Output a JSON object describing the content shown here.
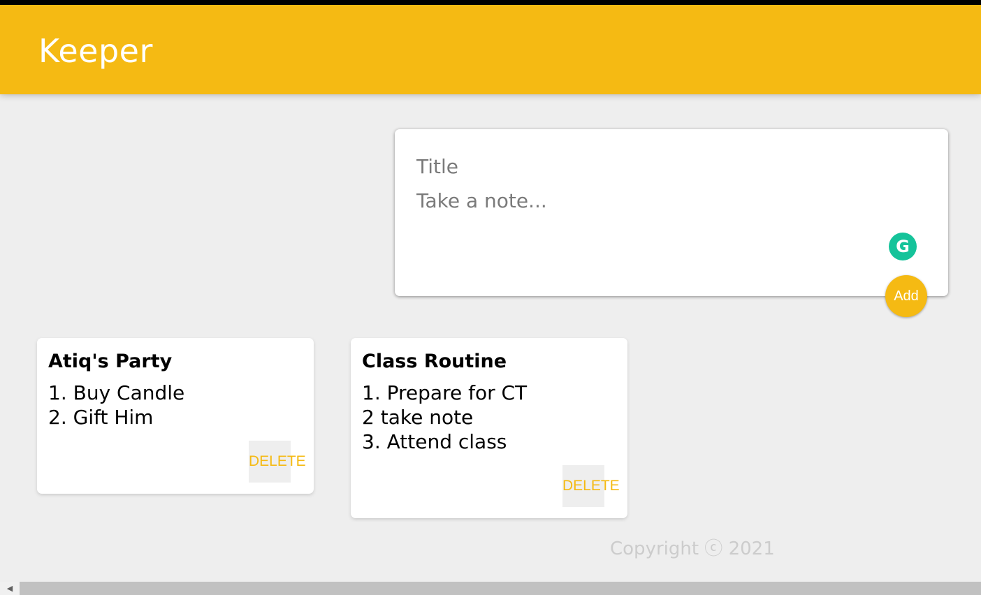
{
  "header": {
    "title": "Keeper"
  },
  "create_note": {
    "title_placeholder": "Title",
    "content_placeholder": "Take a note...",
    "add_label": "Add"
  },
  "notes": [
    {
      "title": "Atiq's Party",
      "lines": [
        "1. Buy Candle",
        "2. Gift Him"
      ],
      "delete_label": "DELETE"
    },
    {
      "title": "Class Routine",
      "lines": [
        "1. Prepare for CT",
        "2 take note",
        "3. Attend class"
      ],
      "delete_label": "DELETE"
    }
  ],
  "footer": {
    "text": "Copyright ⓒ 2021"
  },
  "icons": {
    "grammarly": "grammarly-icon",
    "scroll_left": "chevron-left-icon"
  },
  "colors": {
    "accent": "#f5ba13",
    "background": "#eeeeee",
    "grammarly": "#15c39a"
  }
}
